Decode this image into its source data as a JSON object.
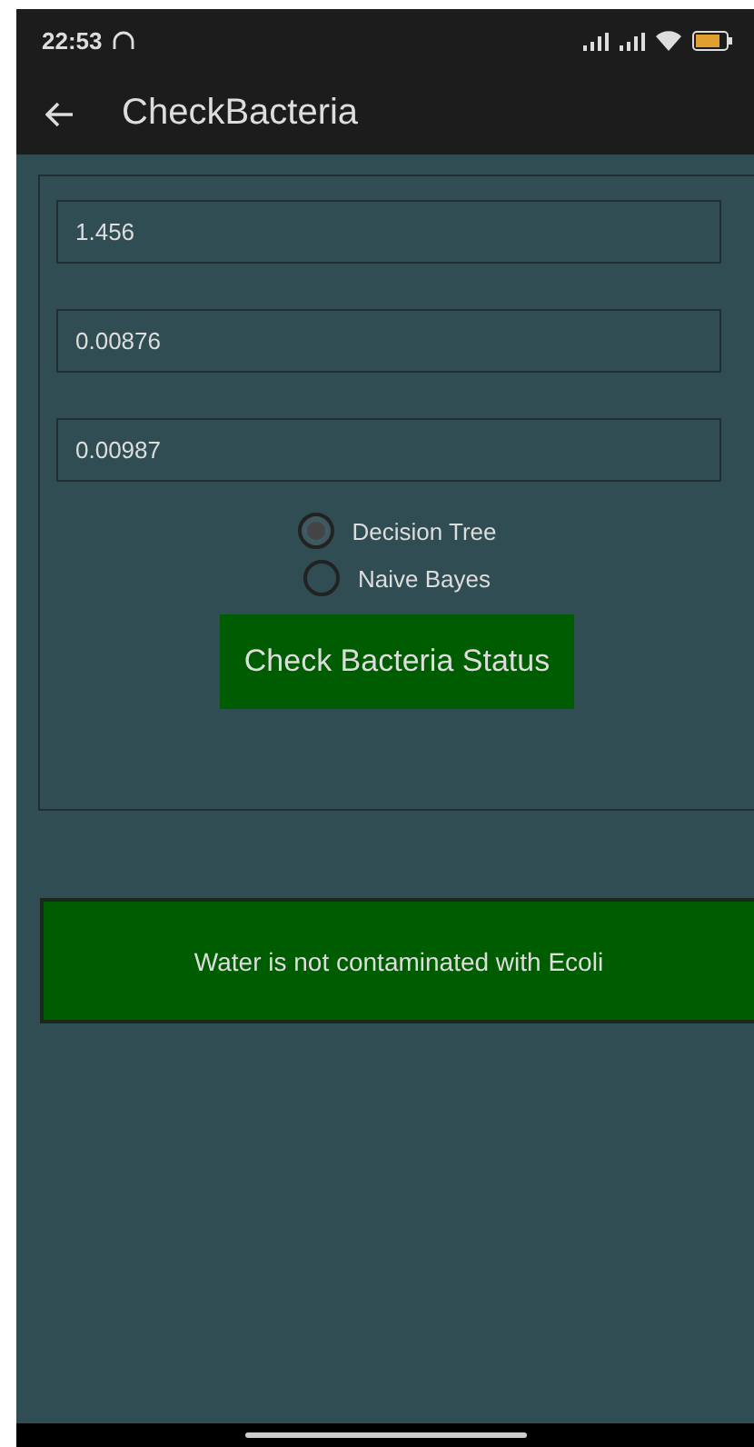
{
  "status_bar": {
    "time": "22:53"
  },
  "app_bar": {
    "title": "CheckBacteria"
  },
  "fields": [
    {
      "value": "1.456"
    },
    {
      "value": "0.00876"
    },
    {
      "value": "0.00987"
    }
  ],
  "algorithms": [
    {
      "label": "Decision Tree",
      "selected": true
    },
    {
      "label": "Naive Bayes",
      "selected": false
    }
  ],
  "check_button": {
    "label": "Check Bacteria Status"
  },
  "result": {
    "text": "Water is not contaminated with Ecoli"
  }
}
